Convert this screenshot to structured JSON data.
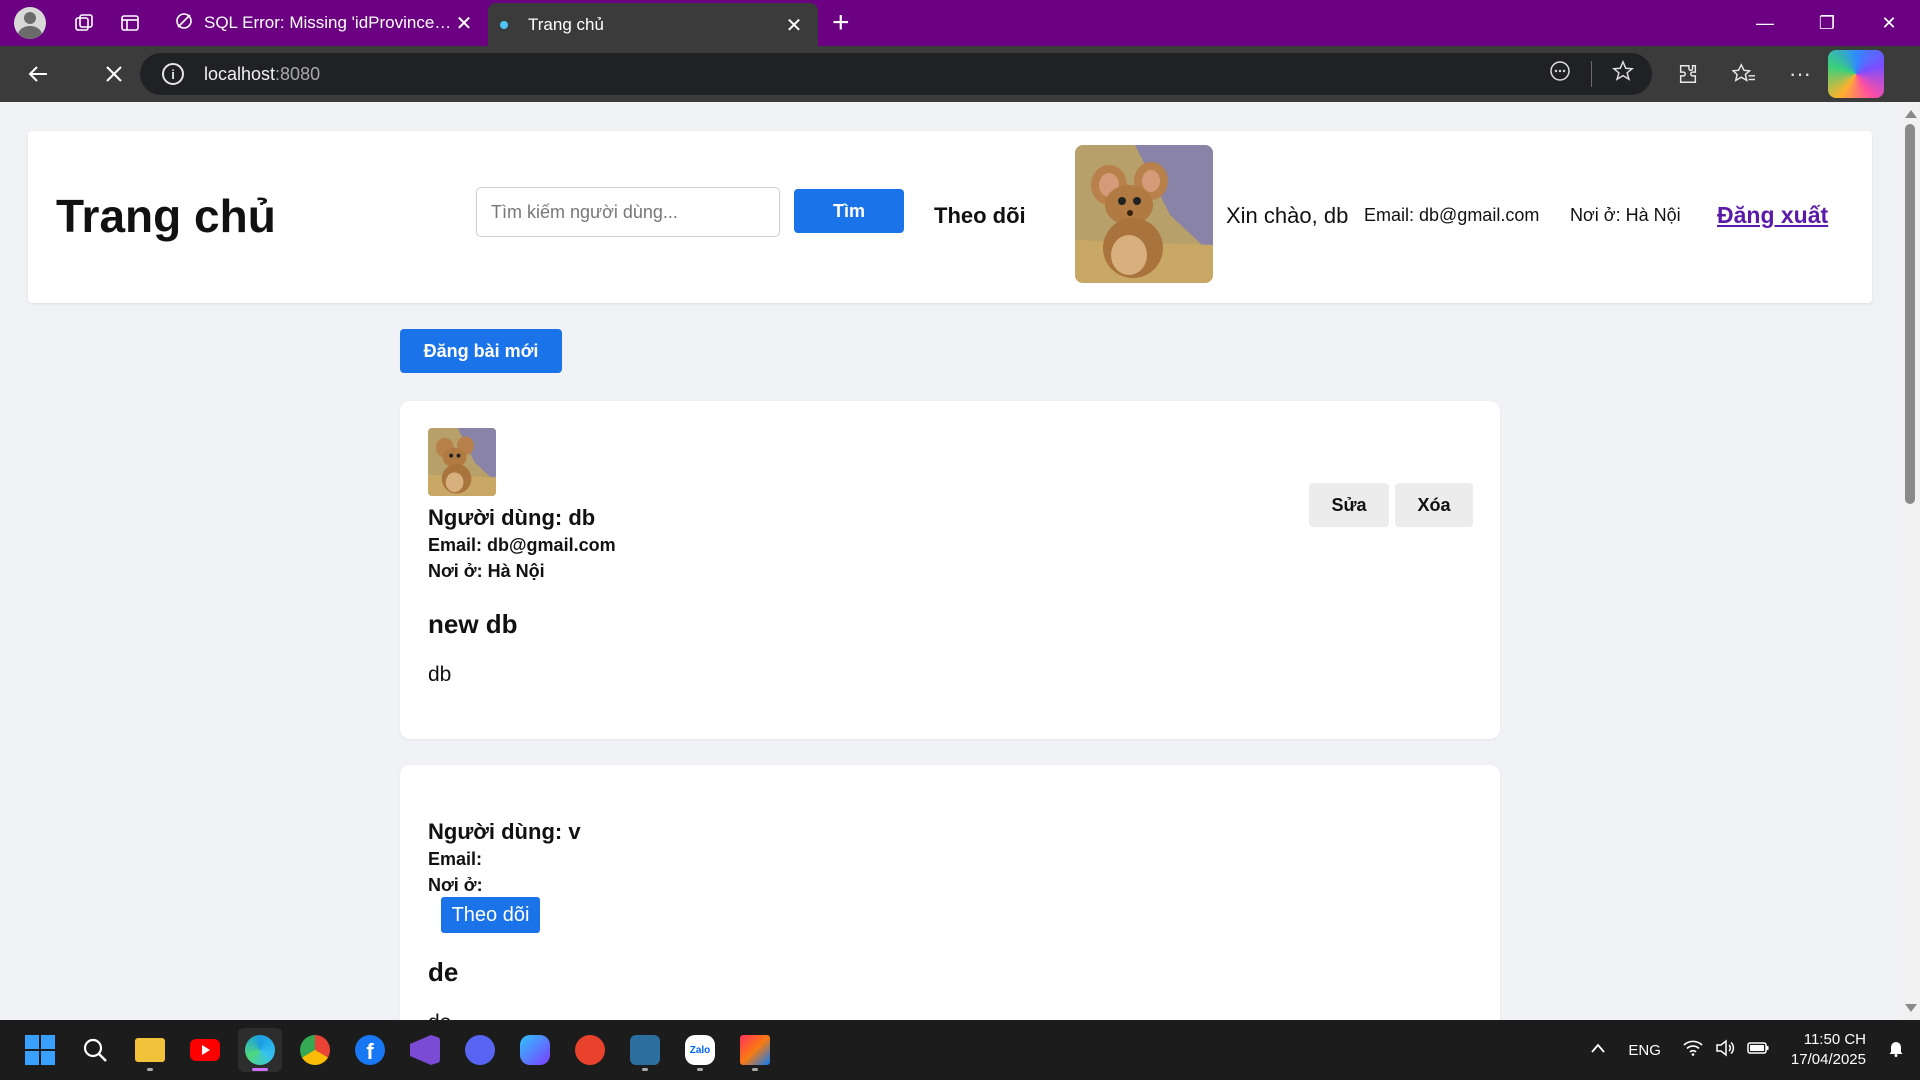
{
  "browser": {
    "tabs": [
      {
        "title": "SQL Error: Missing 'idProvince' Co",
        "close": "✕"
      },
      {
        "title": "Trang chủ",
        "close": "✕"
      }
    ],
    "new_tab": "+",
    "url_host": "localhost",
    "url_port": ":8080"
  },
  "header": {
    "title": "Trang chủ",
    "search_placeholder": "Tìm kiếm người dùng...",
    "search_button": "Tìm",
    "follow_link": "Theo dõi",
    "greeting": "Xin chào, db",
    "email": "Email: db@gmail.com",
    "location": "Nơi ở: Hà Nội",
    "logout": "Đăng xuất"
  },
  "new_post_button": "Đăng bài mới",
  "posts": [
    {
      "user": "Người dùng: db",
      "email": "Email: db@gmail.com",
      "location": "Nơi ở: Hà Nội",
      "title": "new db",
      "body": "db",
      "edit": "Sửa",
      "delete": "Xóa"
    },
    {
      "user": "Người dùng: v",
      "email": "Email:",
      "location": "Nơi ở:",
      "follow": "Theo dõi",
      "title": "de",
      "body": "de"
    }
  ],
  "taskbar": {
    "language": "ENG",
    "time": "11:50 CH",
    "date": "17/04/2025"
  },
  "colors": {
    "tabbar": "#6c0083",
    "primary_button": "#1a73e8",
    "logout_link": "#5b1aa8",
    "page_bg": "#f0f2f5"
  }
}
